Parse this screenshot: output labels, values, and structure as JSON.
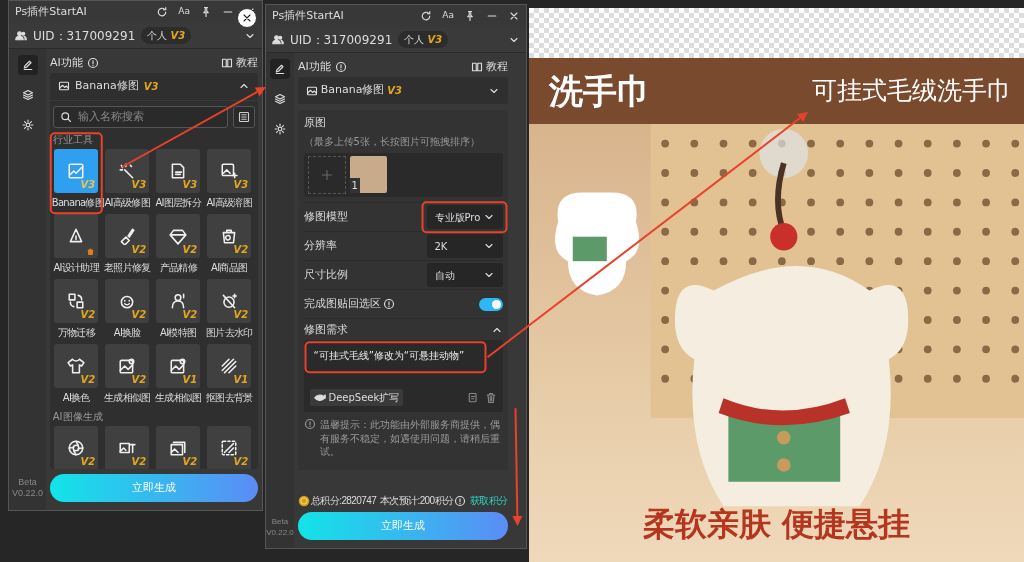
{
  "left_panel": {
    "title": "Ps插件StartAI",
    "font_button": "Aa",
    "uid": "UID：317009291",
    "plan": "个人",
    "plan_level": "V3",
    "sidebar": [
      {
        "selected": true
      },
      {
        "selected": false
      },
      {
        "selected": false
      }
    ],
    "section_label": "AI功能",
    "tutorial": "教程",
    "tool": {
      "name": "Banana修图",
      "version": "V3",
      "expanded": true
    },
    "search": {
      "placeholder": "输入名称搜索"
    },
    "groups": [
      {
        "title": "行业工具",
        "tools": [
          {
            "label": "Banana修图",
            "version": "V3",
            "selected": true
          },
          {
            "label": "AI高级修图",
            "version": "V3",
            "selected": false
          },
          {
            "label": "AI图层拆分",
            "version": "V3",
            "selected": false
          },
          {
            "label": "AI高级溶图",
            "version": "V3",
            "selected": false
          },
          {
            "label": "AI设计助理",
            "tag_icon": true,
            "selected": false
          },
          {
            "label": "老照片修复",
            "version": "V2",
            "selected": false
          },
          {
            "label": "产品精修",
            "version": "V2",
            "selected": false
          },
          {
            "label": "AI商品图",
            "version": "V2",
            "selected": false
          },
          {
            "label": "万物迁移",
            "version": "V2",
            "selected": false
          },
          {
            "label": "AI换脸",
            "version": "V2",
            "selected": false
          },
          {
            "label": "AI模特图",
            "version": "V2",
            "selected": false
          },
          {
            "label": "图片去水印",
            "version": "V2",
            "selected": false
          },
          {
            "label": "AI换色",
            "version": "V2",
            "selected": false
          },
          {
            "label": "生成相似图",
            "version": "V2",
            "selected": false
          },
          {
            "label": "生成相似图",
            "version": "V1",
            "selected": false
          },
          {
            "label": "抠图去背景",
            "version": "V1",
            "selected": false
          }
        ]
      },
      {
        "title": "AI图像生成",
        "tools": [
          {
            "version": "V2",
            "selected": false
          },
          {
            "version": "V2",
            "selected": false
          },
          {
            "version": "V2",
            "selected": false
          },
          {
            "version": "V2",
            "selected": false
          }
        ]
      }
    ],
    "beta": "Beta",
    "version": "V0.22.0",
    "generate": "立即生成"
  },
  "middle_panel": {
    "title": "Ps插件StartAI",
    "font_button": "Aa",
    "uid": "UID：317009291",
    "plan": "个人",
    "plan_level": "V3",
    "sidebar": [
      {
        "selected": true
      },
      {
        "selected": false
      },
      {
        "selected": false
      }
    ],
    "section_label": "AI功能",
    "tutorial": "教程",
    "tool": {
      "name": "Banana修图",
      "version": "V3"
    },
    "upload": {
      "label": "原图",
      "hint": "（最多上传5张，长按图片可拖拽排序）",
      "images": [
        {
          "number": "1"
        }
      ]
    },
    "settings": [
      {
        "kind": "select",
        "label": "修图模型",
        "value": "专业版Pro"
      },
      {
        "kind": "select",
        "label": "分辨率",
        "value": "2K"
      },
      {
        "kind": "select",
        "label": "尺寸比例",
        "value": "自动"
      },
      {
        "kind": "toggle",
        "label": "完成图贴回选区",
        "on": true
      }
    ],
    "prompt": {
      "title": "修图需求",
      "expanded": true,
      "value": "“可挂式毛线”修改为“可悬挂动物”",
      "expand_button": "DeepSeek扩写"
    },
    "notice": "温馨提示：此功能由外部服务商提供，偶有服务不稳定，如遇使用问题，请稍后重试。",
    "points": {
      "total": "总积分:2820747",
      "estimate": "本次预计:200积分",
      "link": "获取积分"
    },
    "beta": "Beta",
    "version": "V0.22.0",
    "generate": "立即生成"
  },
  "canvas": {
    "title": "洗手巾",
    "subtitle": "可挂式毛绒洗手巾",
    "tagline": "柔软亲肤 便捷悬挂"
  }
}
